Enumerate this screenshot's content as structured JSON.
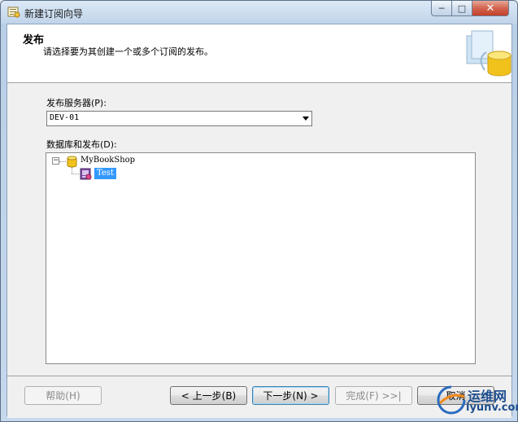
{
  "window": {
    "title": "新建订阅向导",
    "min_glyph": "─",
    "max_glyph": "□",
    "close_glyph": "✕"
  },
  "header": {
    "title": "发布",
    "description": "请选择要为其创建一个或多个订阅的发布。"
  },
  "publisher": {
    "label": "发布服务器(P):",
    "selected": "DEV-01"
  },
  "databases": {
    "label": "数据库和发布(D):",
    "tree": {
      "database": "MyBookShop",
      "publication": "Test",
      "selected": "Test"
    }
  },
  "buttons": {
    "help": "帮助(H)",
    "back": "< 上一步(B)",
    "next": "下一步(N) >",
    "finish": "完成(F) >>|",
    "cancel": "取消"
  },
  "watermark": {
    "line1": "运维网",
    "line2": "iyunv.com"
  },
  "colors": {
    "selection": "#3399ff",
    "titlebar": "#c1d4ea",
    "close_button": "#c4402a"
  }
}
